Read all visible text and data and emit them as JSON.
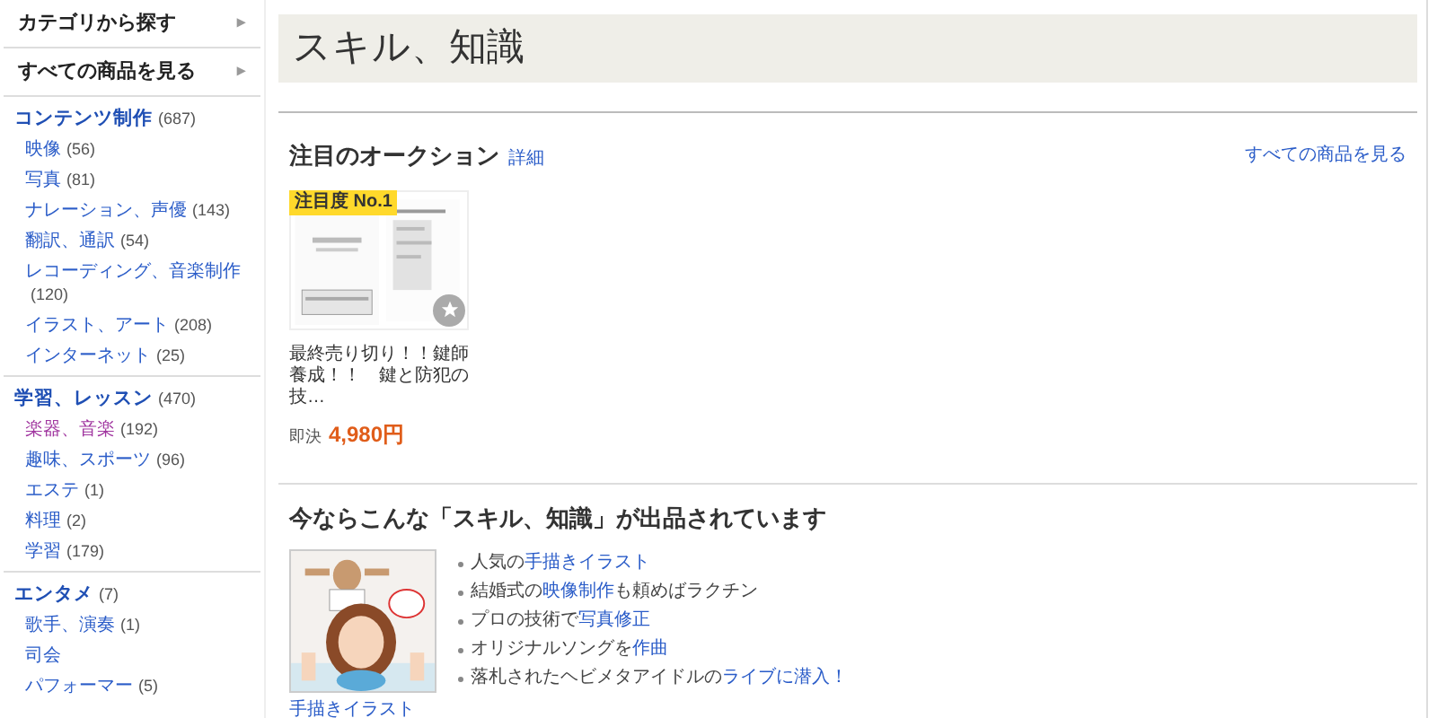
{
  "sidebar": {
    "menus": [
      {
        "label": "カテゴリから探す",
        "arrow": "▸"
      },
      {
        "label": "すべての商品を見る",
        "arrow": "▸"
      }
    ],
    "groups": [
      {
        "label": "コンテンツ制作",
        "count": "(687)",
        "children": [
          {
            "label": "映像",
            "count": "(56)",
            "visited": false
          },
          {
            "label": "写真",
            "count": "(81)",
            "visited": false
          },
          {
            "label": "ナレーション、声優",
            "count": "(143)",
            "visited": false
          },
          {
            "label": "翻訳、通訳",
            "count": "(54)",
            "visited": false
          },
          {
            "label": "レコーディング、音楽制作",
            "count": "(120)",
            "visited": false
          },
          {
            "label": "イラスト、アート",
            "count": "(208)",
            "visited": false
          },
          {
            "label": "インターネット",
            "count": "(25)",
            "visited": false
          }
        ]
      },
      {
        "label": "学習、レッスン",
        "count": "(470)",
        "children": [
          {
            "label": "楽器、音楽",
            "count": "(192)",
            "visited": true
          },
          {
            "label": "趣味、スポーツ",
            "count": "(96)",
            "visited": false
          },
          {
            "label": "エステ",
            "count": "(1)",
            "visited": false
          },
          {
            "label": "料理",
            "count": "(2)",
            "visited": false
          },
          {
            "label": "学習",
            "count": "(179)",
            "visited": false
          }
        ]
      },
      {
        "label": "エンタメ",
        "count": "(7)",
        "children": [
          {
            "label": "歌手、演奏",
            "count": "(1)",
            "visited": false
          },
          {
            "label": "司会",
            "visited": false
          },
          {
            "label": "パフォーマー",
            "count": "(5)",
            "visited": false
          }
        ]
      }
    ]
  },
  "page_title": "スキル、知識",
  "featured": {
    "title": "注目のオークション",
    "details_link": "詳細",
    "all_link": "すべての商品を見る",
    "items": [
      {
        "badge": "注目度 No.1",
        "title": "最終売り切り！！鍵師養成！！　鍵と防犯の技…",
        "price_label": "即決",
        "price": "4,980円"
      }
    ]
  },
  "promo": {
    "title": "今ならこんな「スキル、知識」が出品されています",
    "caption": "手描きイラスト",
    "bullets": [
      [
        {
          "text": "人気の"
        },
        {
          "text": "手描きイラスト",
          "link": true
        }
      ],
      [
        {
          "text": "結婚式の"
        },
        {
          "text": "映像制作",
          "link": true
        },
        {
          "text": "も頼めばラクチン"
        }
      ],
      [
        {
          "text": "プロの技術で"
        },
        {
          "text": "写真修正",
          "link": true
        }
      ],
      [
        {
          "text": "オリジナルソングを"
        },
        {
          "text": "作曲",
          "link": true
        }
      ],
      [
        {
          "text": "落札されたヘビメタアイドルの"
        },
        {
          "text": "ライブに潜入！",
          "link": true
        }
      ]
    ]
  }
}
